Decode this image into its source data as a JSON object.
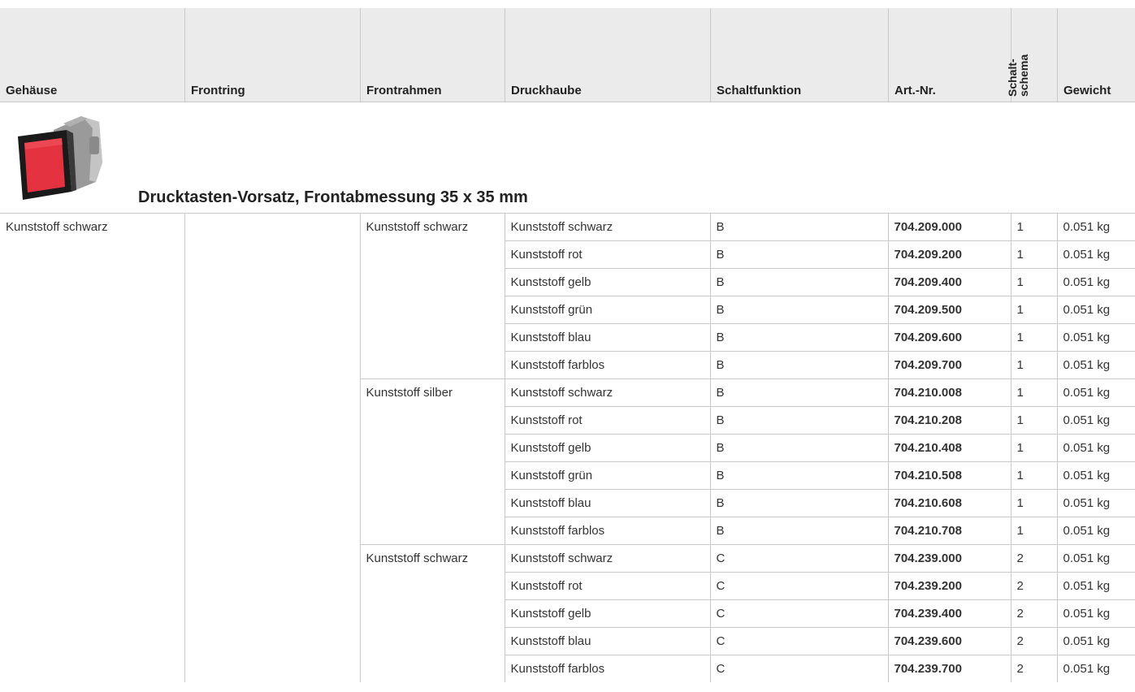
{
  "header": {
    "gehaeuse": "Gehäuse",
    "frontring": "Frontring",
    "frontrahmen": "Frontrahmen",
    "druckhaube": "Druckhaube",
    "schaltfunktion": "Schaltfunktion",
    "artnr": "Art.-Nr.",
    "schaltschema_line1": "Schalt-",
    "schaltschema_line2": "schema",
    "gewicht": "Gewicht"
  },
  "section": {
    "title": "Drucktasten-Vorsatz, Frontabmessung 35 x 35 mm",
    "image": "red-square-pushbutton-attachment"
  },
  "gehaeuse": "Kunststoff schwarz",
  "frontring": "",
  "groups": [
    {
      "frontrahmen": "Kunststoff schwarz",
      "rows": [
        {
          "druckhaube": "Kunststoff schwarz",
          "funktion": "B",
          "art": "704.209.000",
          "schema": "1",
          "gewicht": "0.051 kg"
        },
        {
          "druckhaube": "Kunststoff rot",
          "funktion": "B",
          "art": "704.209.200",
          "schema": "1",
          "gewicht": "0.051 kg"
        },
        {
          "druckhaube": "Kunststoff gelb",
          "funktion": "B",
          "art": "704.209.400",
          "schema": "1",
          "gewicht": "0.051 kg"
        },
        {
          "druckhaube": "Kunststoff grün",
          "funktion": "B",
          "art": "704.209.500",
          "schema": "1",
          "gewicht": "0.051 kg"
        },
        {
          "druckhaube": "Kunststoff blau",
          "funktion": "B",
          "art": "704.209.600",
          "schema": "1",
          "gewicht": "0.051 kg"
        },
        {
          "druckhaube": "Kunststoff farblos",
          "funktion": "B",
          "art": "704.209.700",
          "schema": "1",
          "gewicht": "0.051 kg"
        }
      ]
    },
    {
      "frontrahmen": "Kunststoff silber",
      "rows": [
        {
          "druckhaube": "Kunststoff schwarz",
          "funktion": "B",
          "art": "704.210.008",
          "schema": "1",
          "gewicht": "0.051 kg"
        },
        {
          "druckhaube": "Kunststoff rot",
          "funktion": "B",
          "art": "704.210.208",
          "schema": "1",
          "gewicht": "0.051 kg"
        },
        {
          "druckhaube": "Kunststoff gelb",
          "funktion": "B",
          "art": "704.210.408",
          "schema": "1",
          "gewicht": "0.051 kg"
        },
        {
          "druckhaube": "Kunststoff grün",
          "funktion": "B",
          "art": "704.210.508",
          "schema": "1",
          "gewicht": "0.051 kg"
        },
        {
          "druckhaube": "Kunststoff blau",
          "funktion": "B",
          "art": "704.210.608",
          "schema": "1",
          "gewicht": "0.051 kg"
        },
        {
          "druckhaube": "Kunststoff farblos",
          "funktion": "B",
          "art": "704.210.708",
          "schema": "1",
          "gewicht": "0.051 kg"
        }
      ]
    },
    {
      "frontrahmen": "Kunststoff schwarz",
      "rows": [
        {
          "druckhaube": "Kunststoff schwarz",
          "funktion": "C",
          "art": "704.239.000",
          "schema": "2",
          "gewicht": "0.051 kg"
        },
        {
          "druckhaube": "Kunststoff rot",
          "funktion": "C",
          "art": "704.239.200",
          "schema": "2",
          "gewicht": "0.051 kg"
        },
        {
          "druckhaube": "Kunststoff gelb",
          "funktion": "C",
          "art": "704.239.400",
          "schema": "2",
          "gewicht": "0.051 kg"
        },
        {
          "druckhaube": "Kunststoff blau",
          "funktion": "C",
          "art": "704.239.600",
          "schema": "2",
          "gewicht": "0.051 kg"
        },
        {
          "druckhaube": "Kunststoff farblos",
          "funktion": "C",
          "art": "704.239.700",
          "schema": "2",
          "gewicht": "0.051 kg"
        }
      ]
    }
  ]
}
